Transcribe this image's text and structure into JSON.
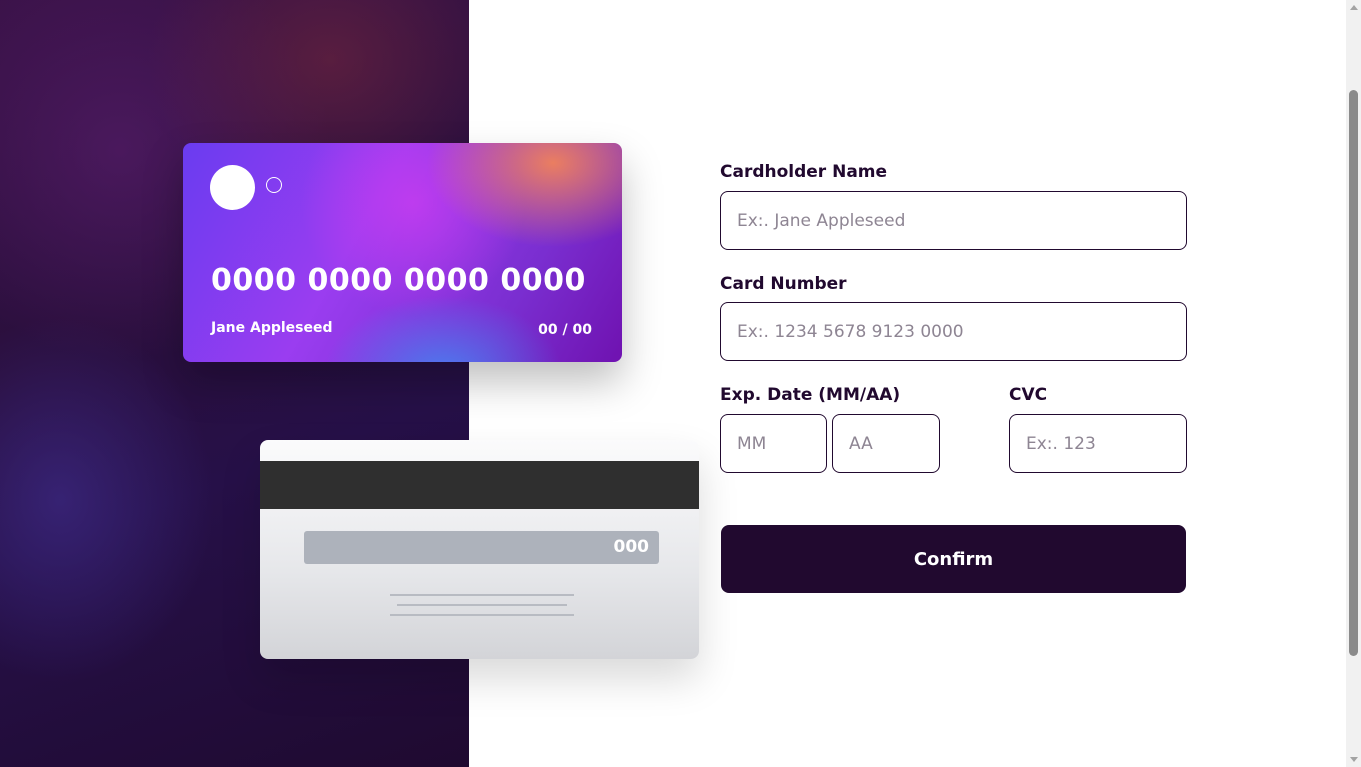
{
  "card_front": {
    "number": "0000 0000 0000 0000",
    "name": "Jane Appleseed",
    "expiry": "00 / 00"
  },
  "card_back": {
    "cvc": "000"
  },
  "form": {
    "cardholder_label": "Cardholder Name",
    "cardholder_placeholder": "Ex:. Jane Appleseed",
    "number_label": "Card Number",
    "number_placeholder": "Ex:. 1234 5678 9123 0000",
    "exp_label": "Exp. Date (MM/AA)",
    "month_placeholder": "MM",
    "year_placeholder": "AA",
    "cvc_label": "CVC",
    "cvc_placeholder": "Ex:. 123",
    "confirm_label": "Confirm"
  },
  "colors": {
    "dark_violet": "#21092f",
    "input_border": "#21092f",
    "placeholder": "#8e8593"
  }
}
